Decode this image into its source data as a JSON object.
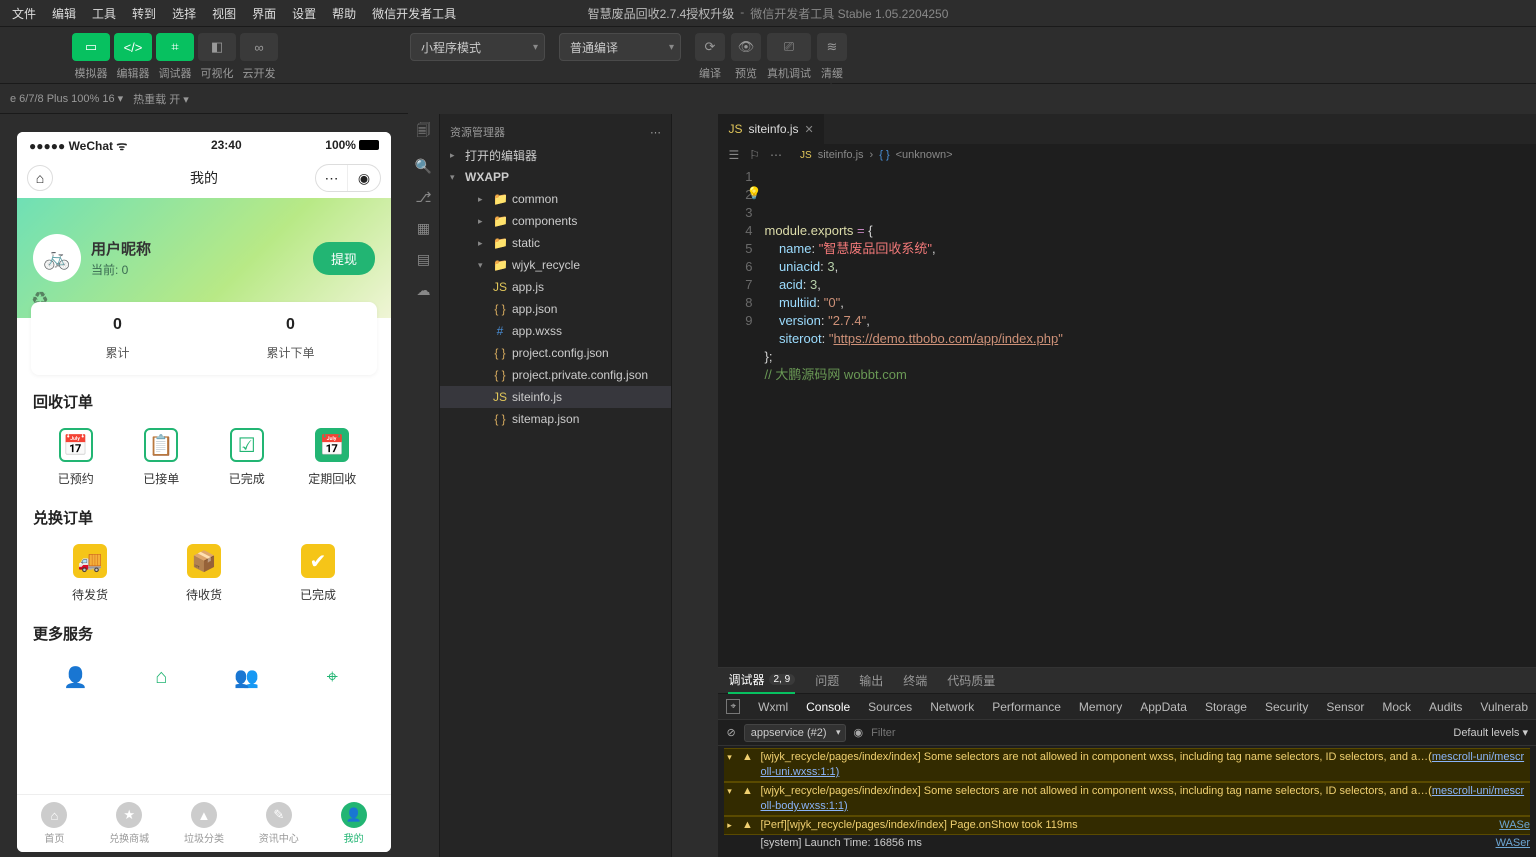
{
  "menubar": [
    "文件",
    "编辑",
    "工具",
    "转到",
    "选择",
    "视图",
    "界面",
    "设置",
    "帮助",
    "微信开发者工具"
  ],
  "window_title": {
    "project": "智慧废品回收2.7.4授权升级",
    "app": "微信开发者工具 Stable 1.05.2204250"
  },
  "toolbar": {
    "left_labels": [
      "模拟器",
      "编辑器",
      "调试器",
      "可视化",
      "云开发"
    ],
    "mode_dropdown": "小程序模式",
    "compile_dropdown": "普通编译",
    "right_labels": [
      "编译",
      "预览",
      "真机调试",
      "清缓存"
    ]
  },
  "sim_bar": {
    "device": "e 6/7/8 Plus 100% 16 ▾",
    "reload": "热重载 开 ▾"
  },
  "simulator": {
    "status": {
      "carrier": "●●●●● WeChat ᯤ",
      "time": "23:40",
      "battery": "100%"
    },
    "nav_title": "我的",
    "user": {
      "name": "用户昵称",
      "sub": "当前: 0",
      "withdraw": "提现"
    },
    "stats": [
      {
        "num": "0",
        "lbl": "累计"
      },
      {
        "num": "0",
        "lbl": "累计下单"
      }
    ],
    "sections": [
      {
        "title": "回收订单",
        "cells": [
          {
            "icon": "📅",
            "label": "已预约",
            "style": "green"
          },
          {
            "icon": "📋",
            "label": "已接单",
            "style": "green"
          },
          {
            "icon": "☑",
            "label": "已完成",
            "style": "green"
          },
          {
            "icon": "📅",
            "label": "定期回收",
            "style": "green-fill"
          }
        ]
      },
      {
        "title": "兑换订单",
        "cells": [
          {
            "icon": "🚚",
            "label": "待发货",
            "style": "yellow"
          },
          {
            "icon": "📦",
            "label": "待收货",
            "style": "yellow"
          },
          {
            "icon": "✔",
            "label": "已完成",
            "style": "yellow"
          }
        ]
      },
      {
        "title": "更多服务",
        "cells": [
          {
            "icon": "👤",
            "label": "",
            "style": "outline"
          },
          {
            "icon": "⌂",
            "label": "",
            "style": "outline"
          },
          {
            "icon": "👥",
            "label": "",
            "style": "outline"
          },
          {
            "icon": "⌖",
            "label": "",
            "style": "outline"
          }
        ]
      }
    ],
    "tabbar": [
      {
        "icon": "⌂",
        "label": "首页"
      },
      {
        "icon": "★",
        "label": "兑换商城"
      },
      {
        "icon": "▲",
        "label": "垃圾分类"
      },
      {
        "icon": "✎",
        "label": "资讯中心"
      },
      {
        "icon": "👤",
        "label": "我的",
        "active": true
      }
    ]
  },
  "explorer": {
    "title": "资源管理器",
    "open_editors": "打开的编辑器",
    "root": "WXAPP",
    "tree": [
      {
        "name": "common",
        "type": "folder",
        "indent": 2
      },
      {
        "name": "components",
        "type": "folder",
        "indent": 2
      },
      {
        "name": "static",
        "type": "folder",
        "indent": 2
      },
      {
        "name": "wjyk_recycle",
        "type": "folder",
        "indent": 2,
        "open": true
      },
      {
        "name": "app.js",
        "type": "js",
        "indent": 2
      },
      {
        "name": "app.json",
        "type": "json",
        "indent": 2
      },
      {
        "name": "app.wxss",
        "type": "wxss",
        "indent": 2
      },
      {
        "name": "project.config.json",
        "type": "json",
        "indent": 2
      },
      {
        "name": "project.private.config.json",
        "type": "json",
        "indent": 2
      },
      {
        "name": "siteinfo.js",
        "type": "js",
        "indent": 2,
        "selected": true
      },
      {
        "name": "sitemap.json",
        "type": "json",
        "indent": 2
      }
    ]
  },
  "editor": {
    "tab": "siteinfo.js",
    "breadcrumb": [
      "siteinfo.js",
      "<unknown>"
    ],
    "code_lines": [
      "module.exports = {",
      "    name: \"智慧废品回收系统\",",
      "    uniacid: 3,",
      "    acid: 3,",
      "    multiid: \"0\",",
      "    version: \"2.7.4\",",
      "    siteroot: \"https://demo.ttbobo.com/app/index.php\"",
      "};",
      "// 大鹏源码网 wobbt.com"
    ]
  },
  "debug_tabs": {
    "items": [
      "调试器",
      "问题",
      "输出",
      "终端",
      "代码质量"
    ],
    "badge": "2, 9",
    "active": "调试器"
  },
  "devtools_tabs": [
    "Wxml",
    "Console",
    "Sources",
    "Network",
    "Performance",
    "Memory",
    "AppData",
    "Storage",
    "Security",
    "Sensor",
    "Mock",
    "Audits",
    "Vulnerab"
  ],
  "devtools_active": "Console",
  "console": {
    "context": "appservice (#2)",
    "filter_placeholder": "Filter",
    "levels": "Default levels ▾",
    "logs": [
      {
        "type": "warn",
        "msg": "[wjyk_recycle/pages/index/index] Some selectors are not allowed in component wxss, including tag name selectors, ID selectors, and a…",
        "link": "scroll-uni/mescroll-uni.wxss:1:1)"
      },
      {
        "type": "warn",
        "msg": "[wjyk_recycle/pages/index/index] Some selectors are not allowed in component wxss, including tag name selectors, ID selectors, and a…",
        "link": "scroll-uni/mescroll-body.wxss:1:1)"
      },
      {
        "type": "warn",
        "collapsed": true,
        "msg": "[Perf][wjyk_recycle/pages/index/index] Page.onShow took 119ms",
        "src": "WASe"
      },
      {
        "type": "info",
        "msg": "[system] Launch Time: 16856 ms",
        "src": "WASer"
      }
    ]
  }
}
